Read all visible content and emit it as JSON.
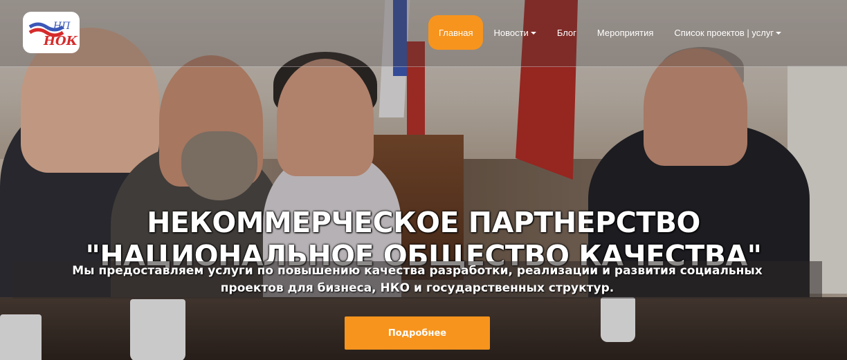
{
  "logo": {
    "text_top": "НП",
    "text_bottom": "НОК"
  },
  "nav": {
    "items": [
      {
        "label": "Главная",
        "active": true,
        "dropdown": false
      },
      {
        "label": "Новости",
        "active": false,
        "dropdown": true
      },
      {
        "label": "Блог",
        "active": false,
        "dropdown": false
      },
      {
        "label": "Мероприятия",
        "active": false,
        "dropdown": false
      },
      {
        "label": "Список проектов | услуг",
        "active": false,
        "dropdown": true
      }
    ]
  },
  "hero": {
    "title_line1": "НЕКОММЕРЧЕСКОЕ ПАРТНЕРСТВО",
    "title_line2": "\"НАЦИОНАЛЬНОЕ ОБЩЕСТВО КАЧЕСТВА\"",
    "subtitle_line1": "Мы предоставляем услуги по повышению качества разработки, реализации и развития социальных",
    "subtitle_line2": "проектов для бизнеса, НКО и государственных структур.",
    "button_label": "Подробнее"
  },
  "colors": {
    "accent": "#f7941d",
    "text": "#ffffff"
  }
}
